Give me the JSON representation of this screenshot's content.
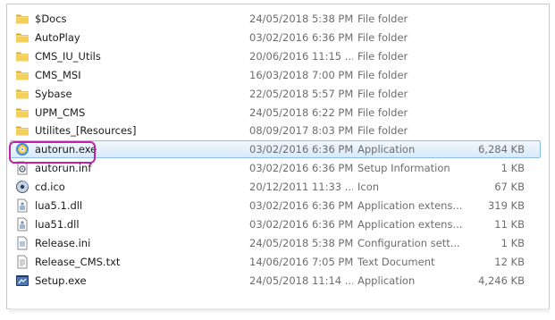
{
  "files": [
    {
      "name": "$Docs",
      "date": "24/05/2018 5:38 PM",
      "type": "File folder",
      "size": "",
      "icon": "folder-icon"
    },
    {
      "name": "AutoPlay",
      "date": "03/02/2016 6:36 PM",
      "type": "File folder",
      "size": "",
      "icon": "folder-icon"
    },
    {
      "name": "CMS_IU_Utils",
      "date": "20/06/2016 11:15 ...",
      "type": "File folder",
      "size": "",
      "icon": "folder-icon"
    },
    {
      "name": "CMS_MSI",
      "date": "16/03/2018 7:00 PM",
      "type": "File folder",
      "size": "",
      "icon": "folder-icon"
    },
    {
      "name": "Sybase",
      "date": "22/05/2018 5:57 PM",
      "type": "File folder",
      "size": "",
      "icon": "folder-icon"
    },
    {
      "name": "UPM_CMS",
      "date": "24/05/2018 6:22 PM",
      "type": "File folder",
      "size": "",
      "icon": "folder-icon"
    },
    {
      "name": "Utilites_[Resources]",
      "date": "08/09/2017 8:03 PM",
      "type": "File folder",
      "size": "",
      "icon": "folder-icon"
    },
    {
      "name": "autorun.exe",
      "date": "03/02/2016 6:36 PM",
      "type": "Application",
      "size": "6,284 KB",
      "icon": "autorun-app-icon",
      "selected": true
    },
    {
      "name": "autorun.inf",
      "date": "03/02/2016 6:36 PM",
      "type": "Setup Information",
      "size": "1 KB",
      "icon": "setup-info-icon"
    },
    {
      "name": "cd.ico",
      "date": "20/12/2011 11:33 ...",
      "type": "Icon",
      "size": "67 KB",
      "icon": "cd-icon"
    },
    {
      "name": "lua5.1.dll",
      "date": "03/02/2016 6:36 PM",
      "type": "Application extens...",
      "size": "319 KB",
      "icon": "dll-icon"
    },
    {
      "name": "lua51.dll",
      "date": "03/02/2016 6:36 PM",
      "type": "Application extens...",
      "size": "11 KB",
      "icon": "dll-icon"
    },
    {
      "name": "Release.ini",
      "date": "24/05/2018 5:38 PM",
      "type": "Configuration sett...",
      "size": "1 KB",
      "icon": "ini-icon"
    },
    {
      "name": "Release_CMS.txt",
      "date": "14/06/2016 7:05 PM",
      "type": "Text Document",
      "size": "12 KB",
      "icon": "text-file-icon"
    },
    {
      "name": "Setup.exe",
      "date": "24/05/2018 11:14 ...",
      "type": "Application",
      "size": "4,246 KB",
      "icon": "setup-app-icon"
    }
  ],
  "colors": {
    "selection_border": "#8fbde6",
    "selection_fill": "#d8eaf9",
    "highlight_outline": "#c21eb0",
    "folder": "#e8c250",
    "secondary_text": "#6d6d6d"
  }
}
